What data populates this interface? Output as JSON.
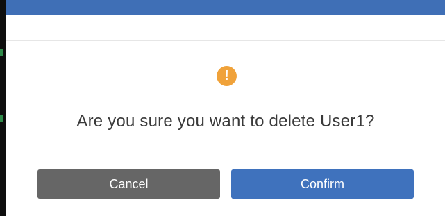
{
  "dialog": {
    "icon": "warning-icon",
    "icon_glyph": "!",
    "message": "Are you sure you want to delete User1?",
    "cancel_label": "Cancel",
    "confirm_label": "Confirm"
  },
  "colors": {
    "topbar": "#3f6fb6",
    "warning": "#f0a23a",
    "cancel": "#666666",
    "confirm": "#3f72bd"
  }
}
